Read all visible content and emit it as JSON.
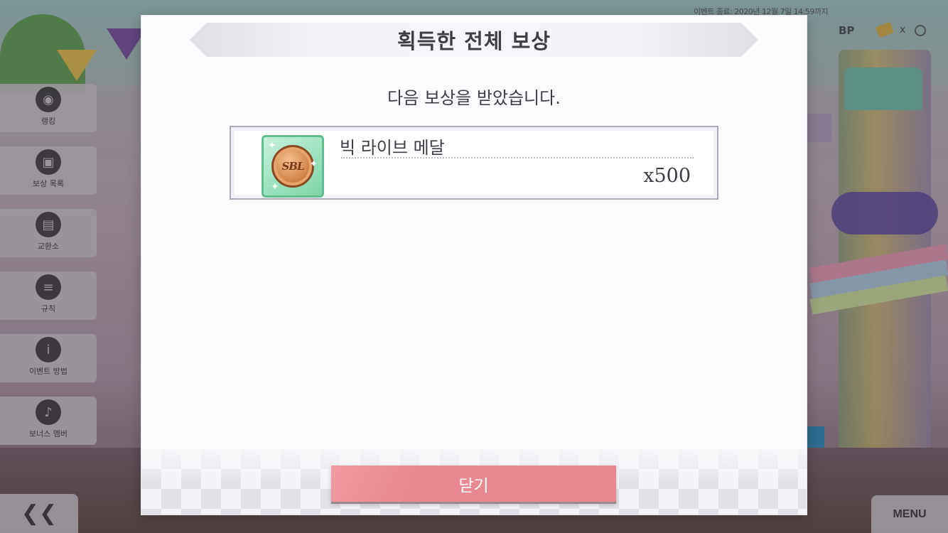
{
  "background": {
    "event_info": "이벤트 종료: 2020년 12월 7일 14:59까지",
    "bp_label": "BP",
    "bp_separator": "x",
    "sidebar": {
      "items": [
        {
          "label": "랭킹",
          "icon": "headphones-icon",
          "glyph": "◉"
        },
        {
          "label": "보상 목록",
          "icon": "gift-box-icon",
          "glyph": "▣"
        },
        {
          "label": "교환소",
          "icon": "shop-icon",
          "glyph": "▤"
        },
        {
          "label": "규칙",
          "icon": "document-icon",
          "glyph": "≡"
        },
        {
          "label": "이벤트 방법",
          "icon": "info-icon",
          "glyph": "i"
        },
        {
          "label": "보너스 멤버",
          "icon": "member-icon",
          "glyph": "♪"
        }
      ]
    },
    "back_label": "❮❮",
    "menu_label": "MENU"
  },
  "dialog": {
    "title": "획득한 전체 보상",
    "subtitle": "다음 보상을 받았습니다.",
    "reward": {
      "name": "빅 라이브 메달",
      "count": "x500",
      "icon": "big-live-medal-icon",
      "icon_text": "SBL"
    },
    "close_label": "닫기"
  }
}
